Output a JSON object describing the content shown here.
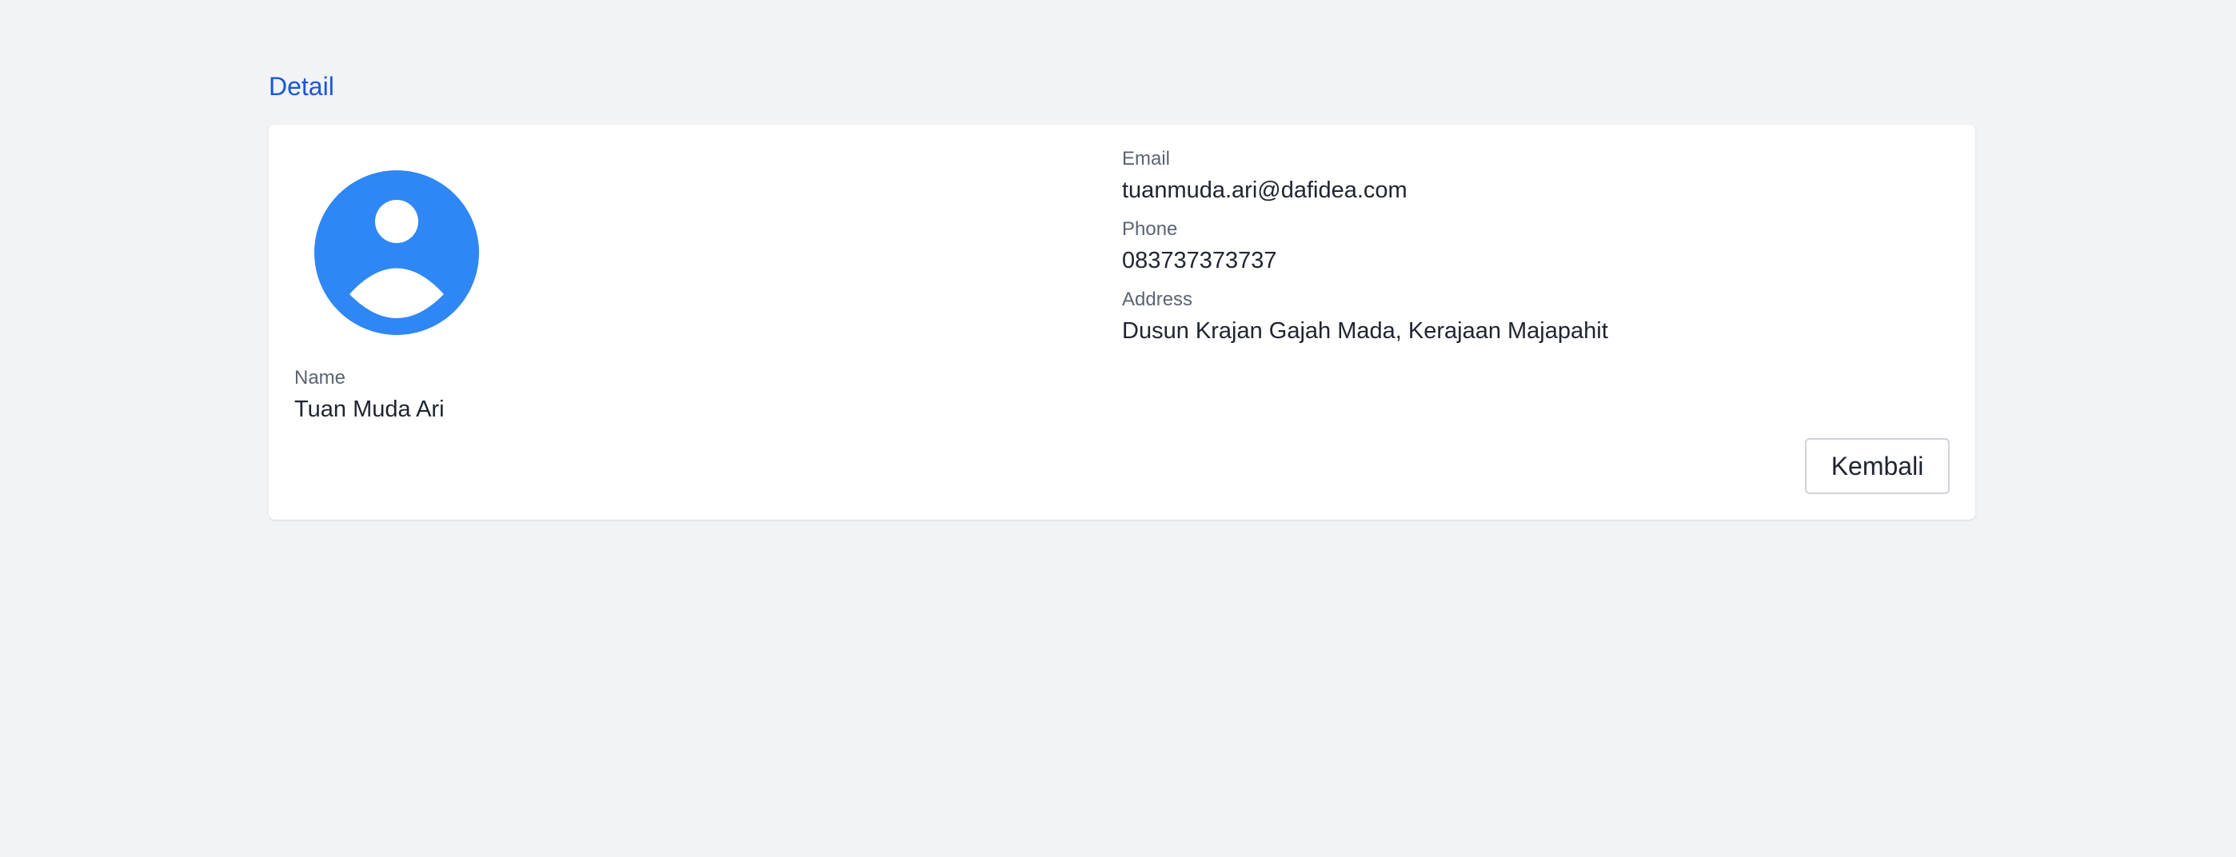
{
  "page": {
    "title": "Detail"
  },
  "profile": {
    "avatar_icon": "user-avatar-icon",
    "avatar_color": "#2f87f6",
    "name": {
      "label": "Name",
      "value": "Tuan Muda Ari"
    },
    "email": {
      "label": "Email",
      "value": "tuanmuda.ari@dafidea.com"
    },
    "phone": {
      "label": "Phone",
      "value": "083737373737"
    },
    "address": {
      "label": "Address",
      "value": "Dusun Krajan Gajah Mada, Kerajaan Majapahit"
    }
  },
  "actions": {
    "back_label": "Kembali"
  },
  "colors": {
    "background": "#f2f3f5",
    "title": "#1a56db",
    "label": "#5b6472",
    "value": "#1f2430"
  }
}
